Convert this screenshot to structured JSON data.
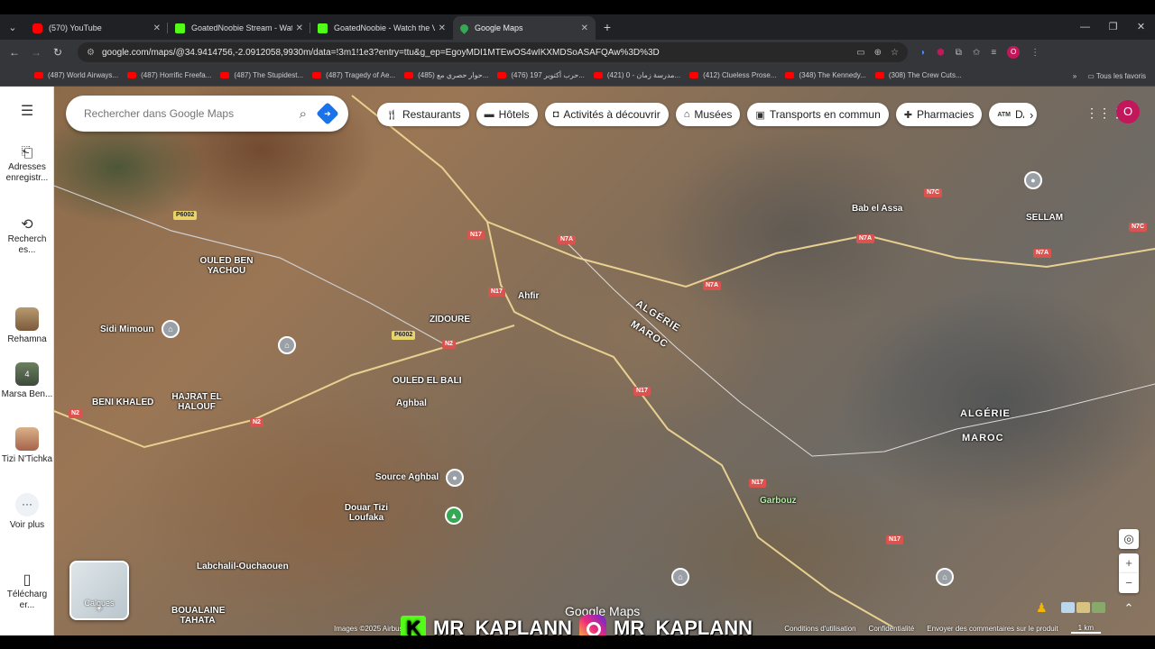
{
  "browser": {
    "tabs": [
      {
        "title": "(570) YouTube",
        "favicon": "youtube-icon",
        "color": "#ff0000"
      },
      {
        "title": "GoatedNoobie Stream - Watch",
        "favicon": "kick-icon",
        "color": "#53fc18"
      },
      {
        "title": "GoatedNoobie - Watch the VO",
        "favicon": "kick-icon",
        "color": "#53fc18"
      },
      {
        "title": "Google Maps",
        "favicon": "maps-icon",
        "color": "#34a853"
      }
    ],
    "url": "google.com/maps/@34.9414756,-2.0912058,9930m/data=!3m1!1e3?entry=ttu&g_ep=EgoyMDI1MTEwOS4wIKXMDSoASAFQAw%3D%3D",
    "bookmarks": [
      "(487) World Airways...",
      "(487) Horrific Freefa...",
      "(487) The Stupidest...",
      "(487) Tragedy of Ae...",
      "(485) حوار حصري مع...",
      "(476) حرب أكتوبر 197...",
      "(421) مدرسة زمان - 0...",
      "(412) Clueless Prose...",
      "(348) The Kennedy...",
      "(308) The Crew Cuts..."
    ],
    "all_bookmarks": "Tous les favoris"
  },
  "sidebar": {
    "items": [
      {
        "label": "Adresses enregistr...",
        "icon": "bookmark-icon"
      },
      {
        "label": "Recherch es...",
        "icon": "history-icon"
      },
      {
        "label": "Rehamna",
        "icon": "place-thumb"
      },
      {
        "label": "Marsa Ben...",
        "icon": "place-thumb",
        "badge": "4"
      },
      {
        "label": "Tizi N'Tichka",
        "icon": "place-thumb"
      },
      {
        "label": "Voir plus",
        "icon": "more-icon"
      },
      {
        "label": "Télécharg er...",
        "icon": "phone-icon"
      }
    ]
  },
  "search": {
    "placeholder": "Rechercher dans Google Maps"
  },
  "chips": [
    {
      "label": "Restaurants",
      "icon": "restaurant-icon"
    },
    {
      "label": "Hôtels",
      "icon": "hotel-icon"
    },
    {
      "label": "Activités à découvrir",
      "icon": "camera-icon"
    },
    {
      "label": "Musées",
      "icon": "museum-icon"
    },
    {
      "label": "Transports en commun",
      "icon": "transit-icon"
    },
    {
      "label": "Pharmacies",
      "icon": "pharmacy-icon"
    },
    {
      "label": "DA",
      "icon": "atm-icon"
    }
  ],
  "account": {
    "initial": "O"
  },
  "map": {
    "places": [
      "OULED BEN YACHOU",
      "Sidi Mimoun",
      "BENI KHALED",
      "HAJRAT EL HALOUF",
      "ZIDOURE",
      "Ahfir",
      "OULED EL BALI",
      "Aghbal",
      "Source Aghbal",
      "Douar Tizi Loufaka",
      "Labchalil-Ouchaouen",
      "BOUALAINE TAHATA",
      "Bab el Assa",
      "SELLAM",
      "Garbouz"
    ],
    "border": {
      "country_a": "ALGÉRIE",
      "country_b": "MAROC"
    },
    "roads": [
      "P6002",
      "N17",
      "N7A",
      "N2",
      "N7C"
    ],
    "layers_label": "Calques",
    "watermark": "Google Maps",
    "footer": [
      "Images ©2025 Airbus",
      "Conditions d'utilisation",
      "Confidentialité",
      "Envoyer des commentaires sur le produit",
      "1 km"
    ]
  },
  "overlay": {
    "handle": "MR_KAPLANN"
  }
}
